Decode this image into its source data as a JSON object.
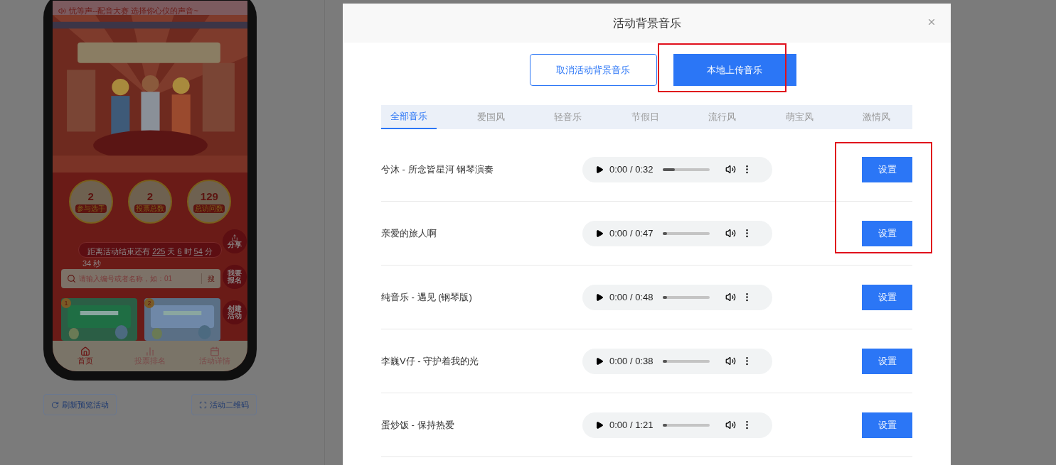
{
  "preview": {
    "marquee": "忧等声--配音大赛 选择你心仪的声音~",
    "stats": [
      {
        "value": "2",
        "label": "参与选手"
      },
      {
        "value": "2",
        "label": "投票总数"
      },
      {
        "value": "129",
        "label": "总访问数"
      }
    ],
    "countdown": {
      "prefix": "距离活动结束还有",
      "parts": [
        {
          "value": "225",
          "unit": "天"
        },
        {
          "value": "6",
          "unit": "时"
        },
        {
          "value": "54",
          "unit": "分"
        }
      ],
      "last": "34 秒"
    },
    "search": {
      "placeholder": "请输入编号或者名称，如：01",
      "button": "搜"
    },
    "side_buttons": [
      "分享",
      "我要报名",
      "创建活动"
    ],
    "cards": [
      {
        "rank": "1",
        "kind": "picture"
      },
      {
        "rank": "2",
        "kind": "picture"
      }
    ],
    "nav": [
      {
        "label": "首页",
        "selected": true
      },
      {
        "label": "投票排名",
        "selected": false
      },
      {
        "label": "活动详情",
        "selected": false
      }
    ]
  },
  "preview_buttons": [
    "刷新预览活动",
    "活动二维码"
  ],
  "dialog": {
    "title": "活动背景音乐",
    "actions": [
      {
        "label": "取消活动背景音乐",
        "kind": "outline"
      },
      {
        "label": "本地上传音乐",
        "kind": "primary"
      }
    ],
    "tabs": [
      {
        "label": "全部音乐",
        "selected": true
      },
      {
        "label": "爱国风",
        "selected": false
      },
      {
        "label": "轻音乐",
        "selected": false
      },
      {
        "label": "节假日",
        "selected": false
      },
      {
        "label": "流行风",
        "selected": false
      },
      {
        "label": "萌宝风",
        "selected": false
      },
      {
        "label": "激情风",
        "selected": false
      }
    ],
    "tracks": [
      {
        "name": "兮沐 - 所念皆星河 钢琴演奏",
        "time": "0:00 / 0:32",
        "level": 0.25,
        "button": "设置"
      },
      {
        "name": "亲爱的旅人啊",
        "time": "0:00 / 0:47",
        "level": 0.08,
        "button": "设置"
      },
      {
        "name": "纯音乐 - 遇见 (钢琴版)",
        "time": "0:00 / 0:48",
        "level": 0.08,
        "button": "设置"
      },
      {
        "name": "李巍V仔 - 守护着我的光",
        "time": "0:00 / 0:38",
        "level": 0.08,
        "button": "设置"
      },
      {
        "name": "蛋炒饭 - 保持热爱",
        "time": "0:00 / 1:21",
        "level": 0.08,
        "button": "设置"
      }
    ]
  }
}
